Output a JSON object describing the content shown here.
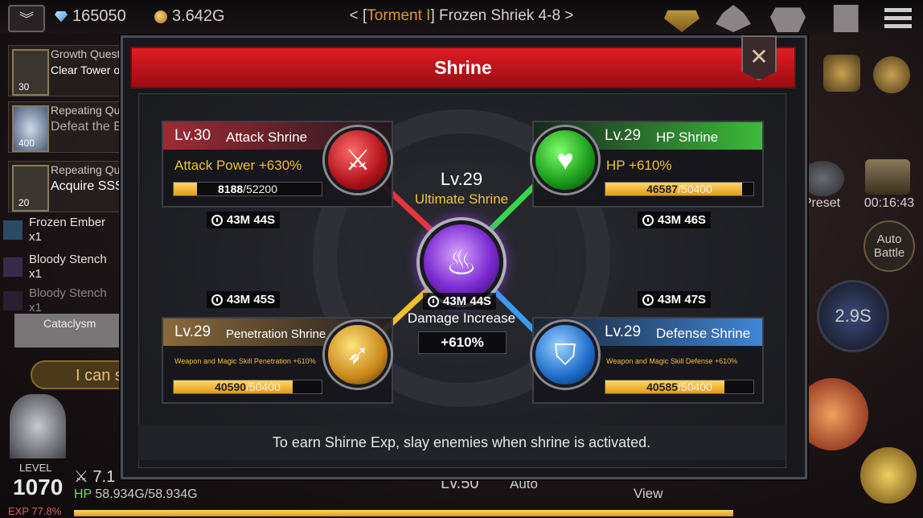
{
  "topbar": {
    "gems": "165050",
    "gold": "3.642G",
    "stage_prefix": "< [",
    "stage_tier": "Torment I",
    "stage_suffix": "] Frozen Shriek 4-8 >"
  },
  "quests": [
    {
      "title": "Growth Quest",
      "subtitle": "Clear Tower of",
      "badge": "30"
    },
    {
      "title": "Repeating Ques",
      "subtitle": "Defeat the E",
      "badge": "400"
    },
    {
      "title": "Repeating Ques",
      "subtitle": "Acquire SSS",
      "badge": "20"
    }
  ],
  "left_items": [
    {
      "name": "Frozen Ember",
      "count": "x1"
    },
    {
      "name": "Bloody Stench",
      "count": "x1"
    },
    {
      "name": "Bloody Stench",
      "count": "x1"
    }
  ],
  "left_extra": {
    "cataclysm": "Cataclysm",
    "chat": "I can s"
  },
  "player": {
    "level_label": "LEVEL",
    "level": "1070",
    "exp": "EXP 77.8%",
    "power": "7.1",
    "hp_label": "HP",
    "hp": "58.934G/58.934G",
    "hp_fraction": 1.0
  },
  "bottom": {
    "lv": "Lv.50",
    "auto": "Auto",
    "view": "View"
  },
  "right": {
    "preset": "Preset",
    "timer": "00:16:43",
    "auto_battle_1": "Auto",
    "auto_battle_2": "Battle",
    "cooldown": "2.9S"
  },
  "modal": {
    "title": "Shrine",
    "footer": "To earn Shirne Exp, slay enemies when shrine is activated.",
    "ultimate": {
      "level": "Lv.29",
      "name": "Ultimate Shrine",
      "timer": "43M 44S",
      "stat_name": "Damage Increase",
      "stat_value": "+610%"
    },
    "shrines": {
      "attack": {
        "level": "Lv.30",
        "name": "Attack Shrine",
        "stat": "Attack Power +630%",
        "exp": "8188",
        "max": "/52200",
        "fraction": 0.157,
        "timer": "43M 44S",
        "color": "#e0383a"
      },
      "hp": {
        "level": "Lv.29",
        "name": "HP Shrine",
        "stat": "HP +610%",
        "exp": "46587",
        "max": "/50400",
        "fraction": 0.924,
        "timer": "43M 46S",
        "color": "#3cbb3a"
      },
      "penetration": {
        "level": "Lv.29",
        "name": "Penetration Shrine",
        "stat": "Weapon and Magic Skill Penetration +610%",
        "exp": "40590",
        "max": "/50400",
        "fraction": 0.805,
        "timer": "43M 45S",
        "color": "#d8a640"
      },
      "defense": {
        "level": "Lv.29",
        "name": "Defense Shrine",
        "stat": "Weapon and Magic Skill Defense +610%",
        "exp": "40585",
        "max": "/50400",
        "fraction": 0.805,
        "timer": "43M 47S",
        "color": "#3f86d8"
      }
    }
  }
}
